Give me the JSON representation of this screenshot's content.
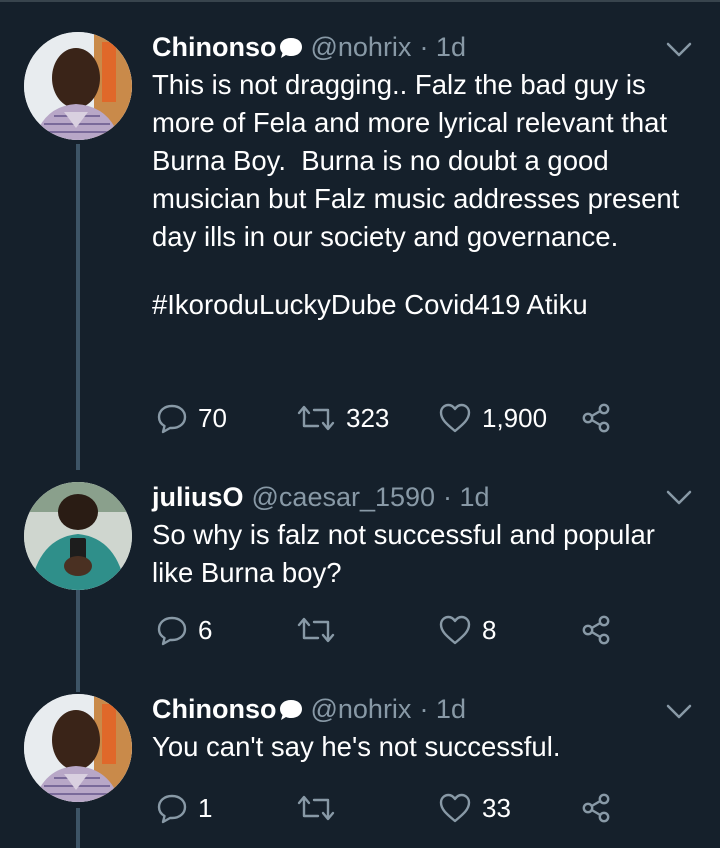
{
  "tweets": [
    {
      "name": "Chinonso",
      "handle": "@nohrix",
      "time": "· 1d",
      "body": "This is not dragging.. Falz the bad guy is more of Fela and more lyrical relevant that Burna Boy.  Burna is no doubt a good musician but Falz music addresses present day ills in our society and governance.",
      "tags": "#IkoroduLuckyDube Covid419 Atiku",
      "replies": "70",
      "retweets": "323",
      "likes": "1,900"
    },
    {
      "name": "juliusO",
      "handle": "@caesar_1590",
      "time": "· 1d",
      "body": "So why is falz not successful and popular  like Burna boy?",
      "replies": "6",
      "retweets": "",
      "likes": "8"
    },
    {
      "name": "Chinonso",
      "handle": "@nohrix",
      "time": "· 1d",
      "body": "You can't say he's not successful.",
      "replies": "1",
      "retweets": "",
      "likes": "33"
    }
  ],
  "icons": {
    "reply": "reply-icon",
    "retweet": "retweet-icon",
    "like": "heart-icon",
    "share": "share-icon",
    "more": "chevron-down-icon",
    "name_emoji": "speech-bubble-icon"
  },
  "colors": {
    "background": "#15202b",
    "secondary_text": "#8899a6",
    "thread_line": "#3d5466"
  }
}
